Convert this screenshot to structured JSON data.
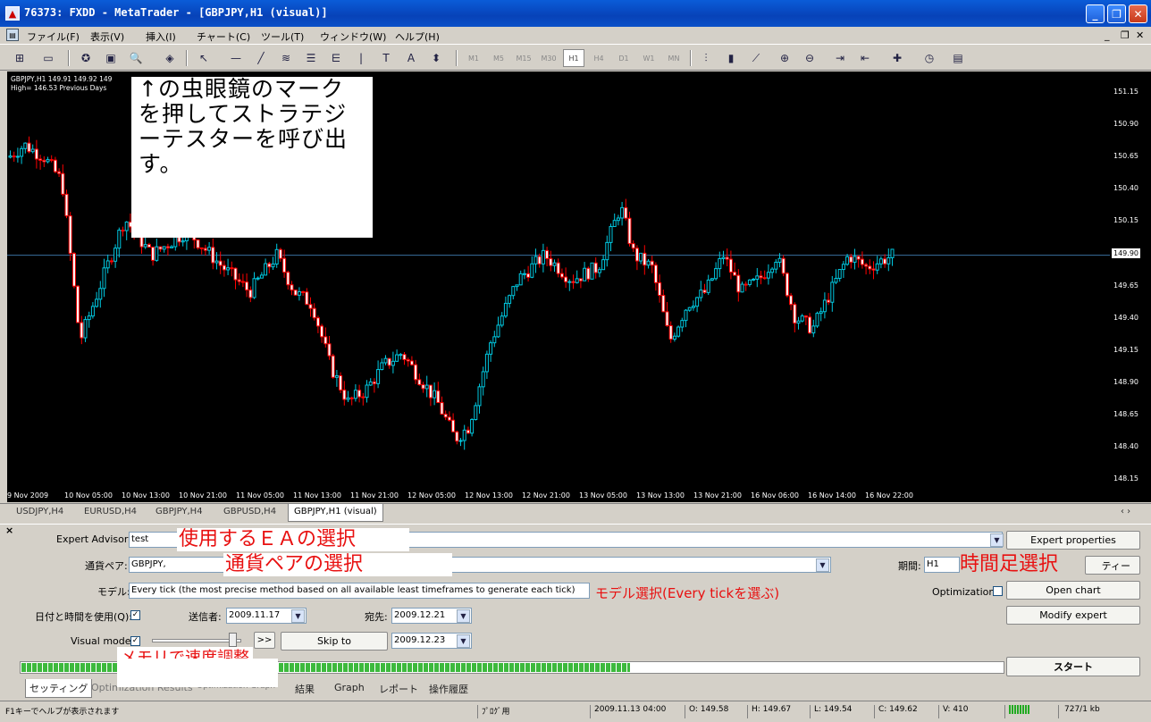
{
  "window": {
    "title": "76373: FXDD - MetaTrader - [GBPJPY,H1 (visual)]"
  },
  "menu": [
    "ファイル(F)",
    "表示(V)",
    "挿入(I)",
    "チャート(C)",
    "ツール(T)",
    "ウィンドウ(W)",
    "ヘルプ(H)"
  ],
  "toolbar": {
    "timeframes": [
      "M1",
      "M5",
      "M15",
      "M30",
      "H1",
      "H4",
      "D1",
      "W1",
      "MN"
    ],
    "active_timeframe": "H1"
  },
  "chart": {
    "info_line1": "GBPJPY,H1  149.91 149.92 149",
    "info_line2": "High= 146.53    Previous Days",
    "current_price": "149.90",
    "y_labels": [
      "151.15",
      "150.90",
      "150.65",
      "150.40",
      "150.15",
      "149.90",
      "149.65",
      "149.40",
      "149.15",
      "148.90",
      "148.65",
      "148.40",
      "148.15"
    ],
    "x_labels": [
      "9 Nov 2009",
      "10 Nov 05:00",
      "10 Nov 13:00",
      "10 Nov 21:00",
      "11 Nov 05:00",
      "11 Nov 13:00",
      "11 Nov 21:00",
      "12 Nov 05:00",
      "12 Nov 13:00",
      "12 Nov 21:00",
      "13 Nov 05:00",
      "13 Nov 13:00",
      "13 Nov 21:00",
      "16 Nov 06:00",
      "16 Nov 14:00",
      "16 Nov 22:00"
    ],
    "note": "↑の虫眼鏡のマーク\nを押してストラテジ\nーテスターを呼び出\nす。",
    "colors": {
      "bull": "#00c8e0",
      "bear": "#ff0000",
      "bg": "#000000",
      "price_line": "#3a6f9e"
    }
  },
  "chart_tabs": [
    "USDJPY,H4",
    "EURUSD,H4",
    "GBPJPY,H4",
    "GBPUSD,H4",
    "GBPJPY,H1 (visual)"
  ],
  "tester": {
    "ea_label": "Expert Advisor:",
    "ea_value": "test",
    "ea_note": "使用するＥＡの選択",
    "expert_properties": "Expert properties",
    "symbol_label": "通貨ペア:",
    "symbol_value": "GBPJPY,",
    "symbol_note": "通貨ペアの選択",
    "period_label": "期間:",
    "period_value": "H1",
    "period_note": "時間足選択",
    "period_btn_tail": "ティー",
    "model_label": "モデル:",
    "model_value": "Every tick (the most precise method based on all available least timeframes to generate each tick)",
    "model_note": "モデル選択(Every tickを選ぶ)",
    "optimization_label": "Optimization",
    "open_chart": "Open chart",
    "use_date_label": "日付と時間を使用(Q):",
    "from_label": "送信者:",
    "from_value": "2009.11.17",
    "to_label": "宛先:",
    "to_value": "2009.12.21",
    "modify_expert": "Modify expert",
    "visual_label": "Visual mode",
    "ff_label": ">>",
    "skip_to": "Skip to",
    "skip_value": "2009.12.23",
    "speed_note": "メモリで速度調整",
    "start": "スタート",
    "progress": 0.62
  },
  "bottom_tabs": [
    "セッティング",
    "Optimization Results",
    "Optimization Graph",
    "結果",
    "Graph",
    "レポート",
    "操作履歴"
  ],
  "status": {
    "help": "F1キーでヘルプが表示されます",
    "profile": "ﾌﾟﾛｸﾞ用",
    "time": "2009.11.13 04:00",
    "open": "O: 149.58",
    "high": "H: 149.67",
    "low": "L: 149.54",
    "close": "C: 149.62",
    "volume": "V: 410",
    "traffic": "727/1 kb"
  }
}
